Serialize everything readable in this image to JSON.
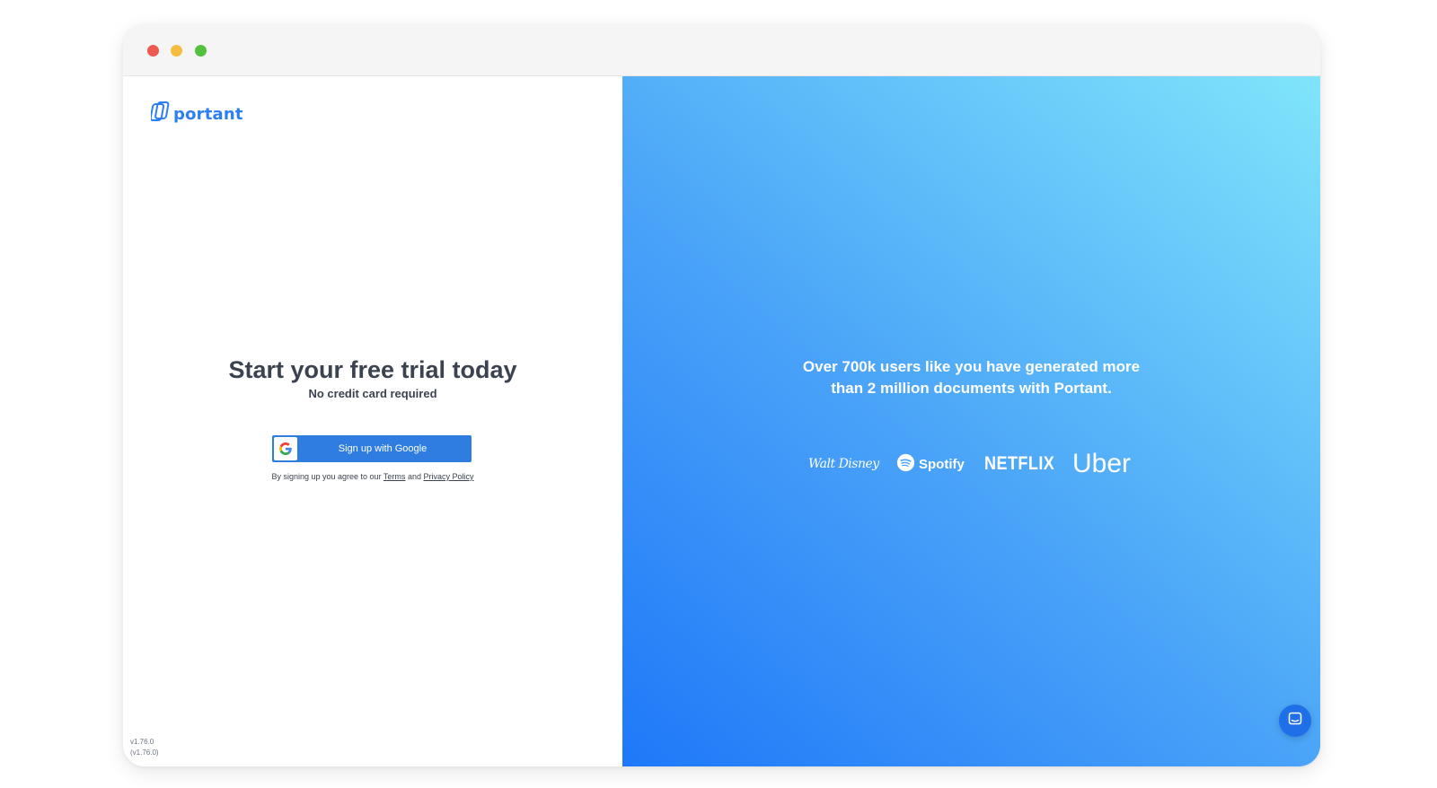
{
  "window": {
    "controls": [
      "close",
      "minimize",
      "zoom"
    ]
  },
  "left": {
    "logo": {
      "text": "portant",
      "icon": "portant-logo-icon"
    },
    "title": "Start your free trial today",
    "subtitle": "No credit card required",
    "google_button": {
      "label": "Sign up with Google",
      "icon": "google-icon"
    },
    "terms": {
      "prefix": "By signing up you agree to our",
      "terms_link": "Terms",
      "and": "and",
      "privacy_link": "Privacy Policy"
    },
    "version": {
      "line1": "v1.76.0",
      "line2": "(v1.76.0)"
    }
  },
  "right": {
    "tagline": {
      "line1": "Over 700k users like you have generated more",
      "line2": "than 2 million documents with Portant."
    },
    "brands": [
      {
        "name": "Walt Disney",
        "text": "Walt Disney"
      },
      {
        "name": "Spotify",
        "text": "Spotify"
      },
      {
        "name": "Netflix",
        "text": "NETFLIX"
      },
      {
        "name": "Uber",
        "text": "Uber"
      }
    ],
    "chat_button": {
      "icon": "chat-icon"
    }
  },
  "colors": {
    "brand_blue": "#2d7ef0",
    "button_blue": "#2f7de1",
    "gradient_start": "#1f78f8",
    "gradient_end": "#80e5fb",
    "text_dark": "#3b4350"
  }
}
